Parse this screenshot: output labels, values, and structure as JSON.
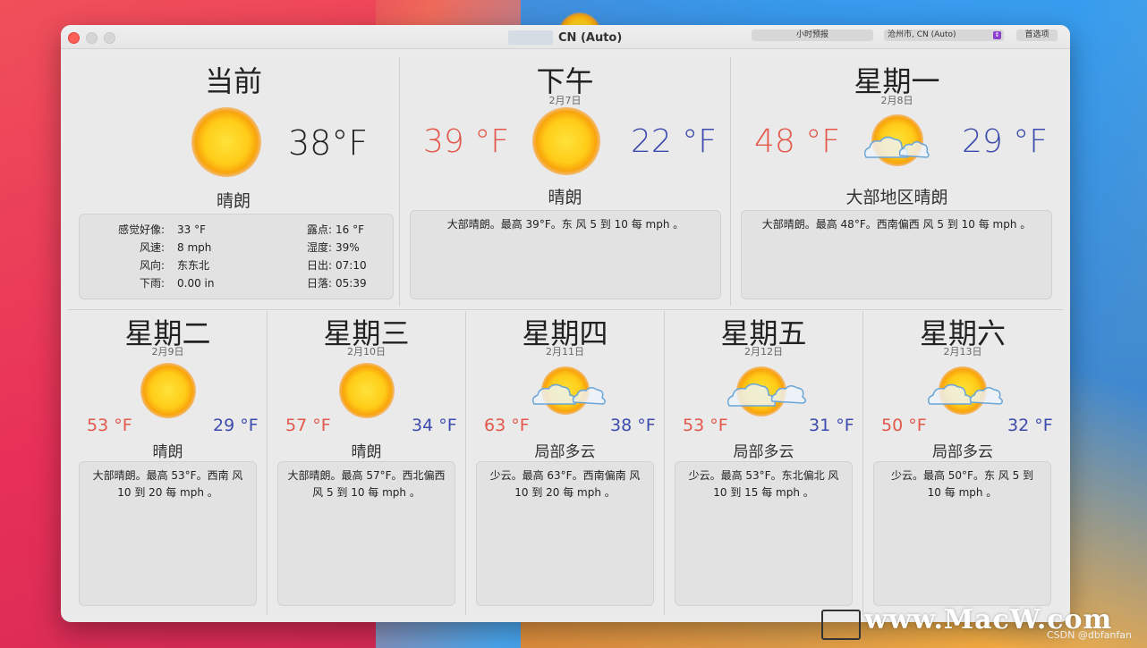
{
  "window": {
    "title": "CN (Auto)",
    "hourly_button": "小时预报",
    "location_select": "沧州市, CN (Auto)",
    "prefs_button": "首选项"
  },
  "current": {
    "title": "当前",
    "temp": "38°F",
    "condition": "晴朗",
    "icon": "sun-icon",
    "details": {
      "feels_like_label": "感觉好像:",
      "feels_like": "33 °F",
      "wind_speed_label": "风速:",
      "wind_speed": "8 mph",
      "wind_dir_label": "风向:",
      "wind_dir": "东东北",
      "rain_label": "下雨:",
      "rain": "0.00 in",
      "dew_label": "露点:",
      "dew": "16 °F",
      "humidity_label": "湿度:",
      "humidity": "39%",
      "sunrise_label": "日出:",
      "sunrise": "07:10",
      "sunset_label": "日落:",
      "sunset": "05:39"
    }
  },
  "afternoon": {
    "title": "下午",
    "date": "2月7日",
    "hi": "39 °F",
    "lo": "22 °F",
    "condition": "晴朗",
    "icon": "sun-icon",
    "summary": "大部晴朗。最高 39°F。东 风 5 到 10 每 mph 。"
  },
  "monday": {
    "title": "星期一",
    "date": "2月8日",
    "hi": "48 °F",
    "lo": "29 °F",
    "condition": "大部地区晴朗",
    "icon": "partly-cloudy-icon",
    "summary": "大部晴朗。最高 48°F。西南偏西 风 5 到 10 每 mph 。"
  },
  "days": [
    {
      "title": "星期二",
      "date": "2月9日",
      "hi": "53 °F",
      "lo": "29 °F",
      "condition": "晴朗",
      "icon": "sun-icon",
      "summary": "大部晴朗。最高 53°F。西南 风 10 到 20 每 mph 。"
    },
    {
      "title": "星期三",
      "date": "2月10日",
      "hi": "57 °F",
      "lo": "34 °F",
      "condition": "晴朗",
      "icon": "sun-icon",
      "summary": "大部晴朗。最高 57°F。西北偏西 风 5 到 10 每 mph 。"
    },
    {
      "title": "星期四",
      "date": "2月11日",
      "hi": "63 °F",
      "lo": "38 °F",
      "condition": "局部多云",
      "icon": "partly-cloudy-icon",
      "summary": "少云。最高 63°F。西南偏南 风 10 到 20 每 mph 。"
    },
    {
      "title": "星期五",
      "date": "2月12日",
      "hi": "53 °F",
      "lo": "31 °F",
      "condition": "局部多云",
      "icon": "partly-cloudy-icon",
      "summary": "少云。最高 53°F。东北偏北 风 10 到 15 每 mph 。"
    },
    {
      "title": "星期六",
      "date": "2月13日",
      "hi": "50 °F",
      "lo": "32 °F",
      "condition": "局部多云",
      "icon": "partly-cloudy-icon",
      "summary": "少云。最高 50°F。东 风 5 到 10 每 mph 。"
    }
  ],
  "watermark": "www.MacW.com",
  "csdn": "CSDN @dbfanfan"
}
